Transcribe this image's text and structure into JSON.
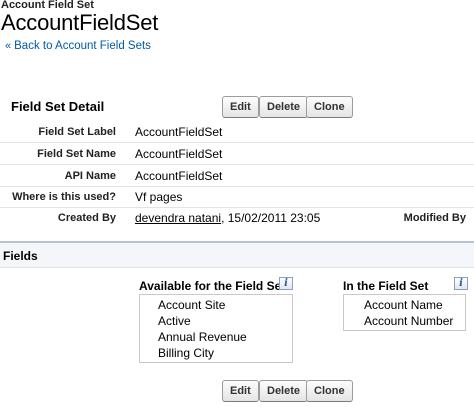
{
  "header": {
    "object_label": "Account Field Set",
    "title": "AccountFieldSet",
    "back_chevron": "«",
    "back_link": "Back to Account Field Sets"
  },
  "detail": {
    "section_title": "Field Set Detail",
    "buttons": {
      "edit": "Edit",
      "delete": "Delete",
      "clone": "Clone"
    },
    "rows": [
      {
        "label": "Field Set Label",
        "value": "AccountFieldSet"
      },
      {
        "label": "Field Set Name",
        "value": "AccountFieldSet"
      },
      {
        "label": "API Name",
        "value": "AccountFieldSet"
      },
      {
        "label": "Where is this used?",
        "value": "Vf pages"
      }
    ],
    "created_by": {
      "label": "Created By",
      "user": "devendra natani",
      "date": ", 15/02/2011 23:05",
      "modified_label": "Modified By"
    }
  },
  "fields": {
    "section_title": "Fields",
    "info_glyph": "i",
    "available": {
      "header": "Available for the Field Set",
      "items": [
        "Account Site",
        "Active",
        "Annual Revenue",
        "Billing City"
      ]
    },
    "in_set": {
      "header": "In the Field Set",
      "items": [
        "Account Name",
        "Account Number"
      ]
    },
    "buttons": {
      "edit": "Edit",
      "delete": "Delete",
      "clone": "Clone"
    }
  },
  "colors": {
    "link": "#015ba7",
    "section_border": "#b9c2cf",
    "row_divider": "#e3e3e3"
  }
}
